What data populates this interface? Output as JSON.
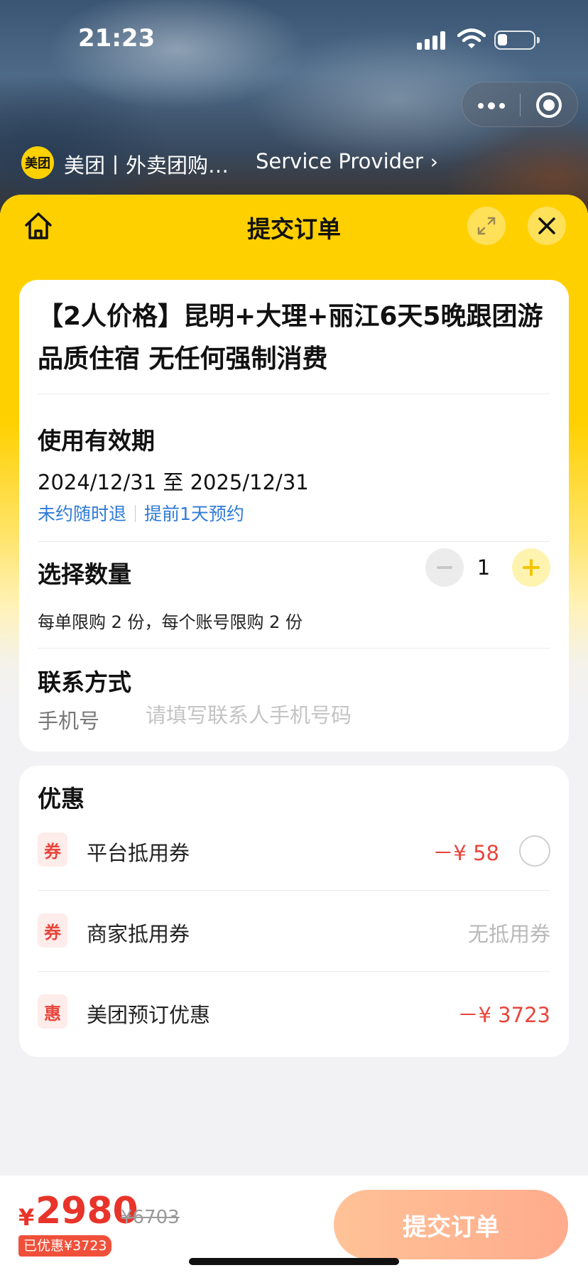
{
  "status_bar": {
    "time": "21:23"
  },
  "provider": {
    "logo_text": "美团",
    "name": "美团丨外卖团购…",
    "link_label": "Service Provider",
    "link_chevron": "›"
  },
  "header": {
    "title": "提交订单"
  },
  "product": {
    "title": "【2人价格】昆明+大理+丽江6天5晚跟团游品质住宿 无任何强制消费"
  },
  "validity": {
    "label": "使用有效期",
    "dates": "2024/12/31 至 2025/12/31",
    "tag_refund": "未约随时退",
    "tag_booking": "提前1天预约"
  },
  "quantity": {
    "label": "选择数量",
    "value": "1",
    "limit_note": "每单限购 2 份，每个账号限购 2 份"
  },
  "contact": {
    "label": "联系方式",
    "phone_label": "手机号",
    "phone_placeholder": "请填写联系人手机号码",
    "phone_value": ""
  },
  "discounts": {
    "title": "优惠",
    "items": [
      {
        "badge": "券",
        "name": "平台抵用券",
        "amount": "－¥ 58"
      },
      {
        "badge": "券",
        "name": "商家抵用券",
        "amount": "无抵用券"
      },
      {
        "badge": "惠",
        "name": "美团预订优惠",
        "amount": "－¥ 3723"
      }
    ]
  },
  "footer": {
    "currency": "¥",
    "price": "2980",
    "original_price": "¥6703",
    "saved": "已优惠¥3723",
    "submit_label": "提交订单"
  },
  "colors": {
    "brand_yellow": "#ffd000",
    "price_red": "#e8342a",
    "link_blue": "#2f7bd8",
    "submit_gradient_start": "#ffc297",
    "submit_gradient_end": "#ffab8c"
  },
  "icons": [
    "home-icon",
    "expand-icon",
    "close-icon",
    "more-icon",
    "target-icon",
    "minus-icon",
    "plus-icon",
    "radio-icon",
    "wifi-icon",
    "battery-icon",
    "signal-icon"
  ]
}
